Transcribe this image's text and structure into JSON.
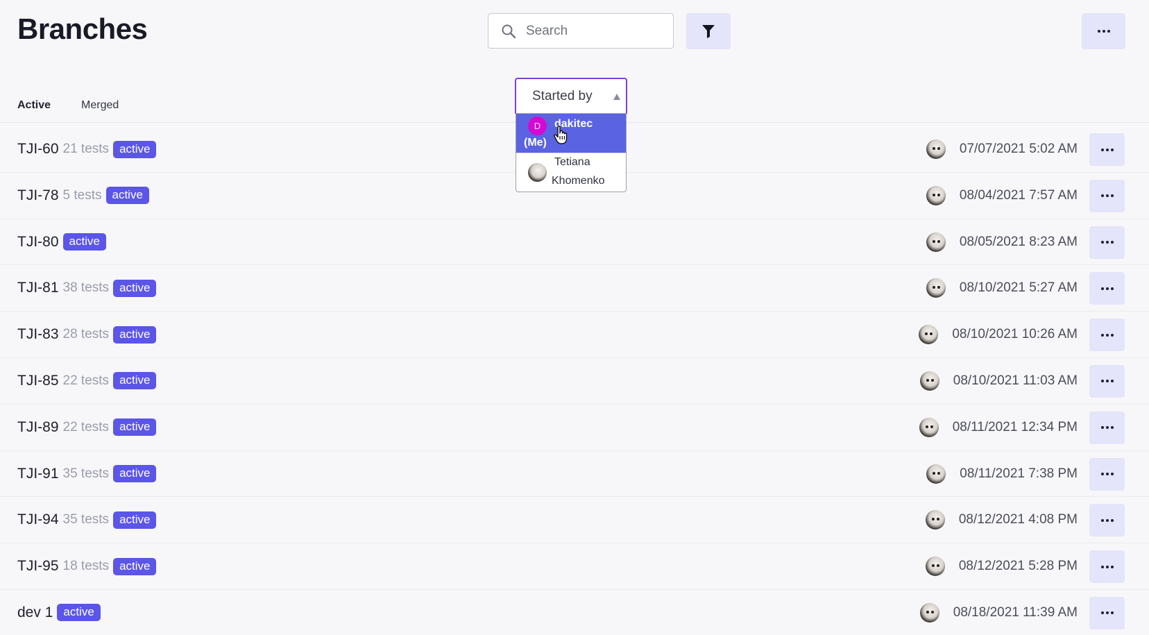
{
  "header": {
    "title": "Branches",
    "search_placeholder": "Search",
    "icons": {
      "search": "search-icon",
      "filter": "filter-icon",
      "more": "more-horizontal-icon"
    }
  },
  "tabs": [
    {
      "label": "Active",
      "active": true
    },
    {
      "label": "Merged",
      "active": false
    }
  ],
  "started_by": {
    "label": "Started by",
    "options": [
      {
        "initial": "D",
        "name_line1": "dakitec",
        "name_line2": "(Me)",
        "selected": true
      },
      {
        "name_line1": "Tetiana",
        "name_line2": "Khomenko",
        "selected": false
      }
    ]
  },
  "branches": [
    {
      "name": "TJI-60",
      "tests": "21 tests",
      "status": "active",
      "timestamp": "07/07/2021 5:02 AM"
    },
    {
      "name": "TJI-78",
      "tests": "5 tests",
      "status": "active",
      "timestamp": "08/04/2021 7:57 AM"
    },
    {
      "name": "TJI-80",
      "tests": "",
      "status": "active",
      "timestamp": "08/05/2021 8:23 AM"
    },
    {
      "name": "TJI-81",
      "tests": "38 tests",
      "status": "active",
      "timestamp": "08/10/2021 5:27 AM"
    },
    {
      "name": "TJI-83",
      "tests": "28 tests",
      "status": "active",
      "timestamp": "08/10/2021 10:26 AM"
    },
    {
      "name": "TJI-85",
      "tests": "22 tests",
      "status": "active",
      "timestamp": "08/10/2021 11:03 AM"
    },
    {
      "name": "TJI-89",
      "tests": "22 tests",
      "status": "active",
      "timestamp": "08/11/2021 12:34 PM"
    },
    {
      "name": "TJI-91",
      "tests": "35 tests",
      "status": "active",
      "timestamp": "08/11/2021 7:38 PM"
    },
    {
      "name": "TJI-94",
      "tests": "35 tests",
      "status": "active",
      "timestamp": "08/12/2021 4:08 PM"
    },
    {
      "name": "TJI-95",
      "tests": "18 tests",
      "status": "active",
      "timestamp": "08/12/2021 5:28 PM"
    },
    {
      "name": "dev 1",
      "tests": "",
      "status": "active",
      "timestamp": "08/18/2021 11:39 AM"
    }
  ],
  "colors": {
    "accent": "#5b55e8",
    "button_bg": "#e4e4fa",
    "select_border": "#7d3fd8",
    "selected_option": "#5a63e2",
    "avatar_initial_bg": "#d40ad4"
  }
}
